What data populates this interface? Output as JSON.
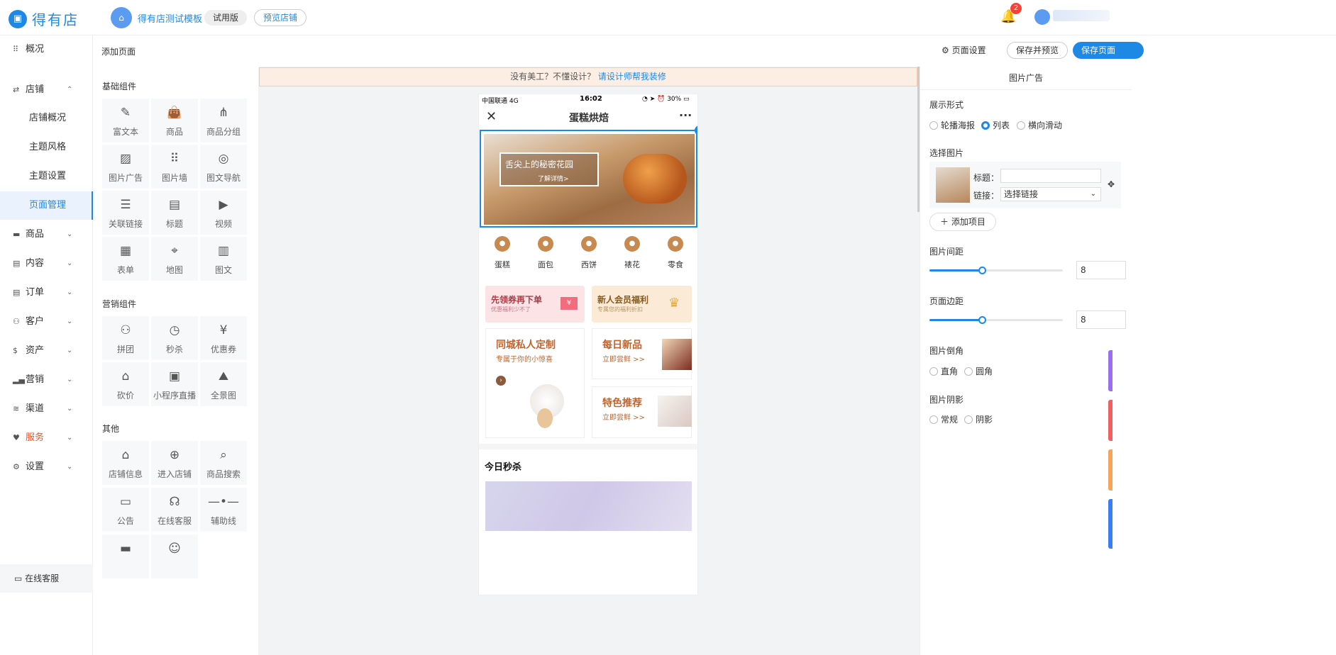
{
  "header": {
    "logo_text": "得有店",
    "shop_name": "得有店测试模板",
    "trial_tag": "试用版",
    "preview_store": "预览店铺",
    "notification_count": "2"
  },
  "sidebar": {
    "overview": "概况",
    "store": "店铺",
    "store_sub": [
      "店铺概况",
      "主题风格",
      "主题设置",
      "页面管理"
    ],
    "items": [
      "商品",
      "内容",
      "订单",
      "客户",
      "资产",
      "营销",
      "渠道",
      "服务",
      "设置"
    ],
    "online_service": "在线客服"
  },
  "subheader": {
    "title": "添加页面",
    "page_settings": "页面设置",
    "save_preview": "保存并预览",
    "save_page": "保存页面"
  },
  "components": {
    "basic_title": "基础组件",
    "basic": [
      "富文本",
      "商品",
      "商品分组",
      "图片广告",
      "图片墙",
      "图文导航",
      "关联链接",
      "标题",
      "视频",
      "表单",
      "地图",
      "图文"
    ],
    "marketing_title": "营销组件",
    "marketing": [
      "拼团",
      "秒杀",
      "优惠券",
      "砍价",
      "小程序直播",
      "全景图"
    ],
    "other_title": "其他",
    "other": [
      "店铺信息",
      "进入店铺",
      "商品搜索",
      "公告",
      "在线客服",
      "辅助线"
    ]
  },
  "canvas": {
    "banner_text": "没有美工？不懂设计？",
    "banner_link": "请设计师帮我装修",
    "status_left": "中国联通  4G",
    "status_time": "16:02",
    "status_right": "30%",
    "nav_title": "蛋糕烘焙",
    "hero_title": "舌尖上的秘密花园",
    "hero_sub": "了解详情>",
    "categories": [
      "蛋糕",
      "面包",
      "西饼",
      "裱花",
      "零食"
    ],
    "promo1_title": "先领券再下单",
    "promo1_sub": "优惠福利少不了",
    "promo2_title": "新人会员福利",
    "promo2_sub": "专属您的福利折扣",
    "card_big_title": "同城私人定制",
    "card_big_sub": "专属于你的小惊喜",
    "card_new_title": "每日新品",
    "card_new_sub": "立即尝鲜 >>",
    "card_rec_title": "特色推荐",
    "card_rec_sub": "立即尝鲜 >>",
    "flash_title": "今日秒杀"
  },
  "props": {
    "panel_title": "图片广告",
    "display_label": "展示形式",
    "display_options": [
      "轮播海报",
      "列表",
      "横向滑动"
    ],
    "display_selected": "列表",
    "choose_image": "选择图片",
    "title_label": "标题：",
    "title_value": "",
    "link_label": "链接：",
    "link_value": "选择链接",
    "add_item": "添加项目",
    "spacing_label": "图片间距",
    "spacing_value": "8",
    "margin_label": "页面边距",
    "margin_value": "8",
    "corner_label": "图片倒角",
    "corner_options": [
      "直角",
      "圆角"
    ],
    "shadow_label": "图片阴影",
    "shadow_options": [
      "常规",
      "阴影"
    ]
  },
  "colors": {
    "accent": "#1e88e5",
    "service": "#f4511e"
  }
}
